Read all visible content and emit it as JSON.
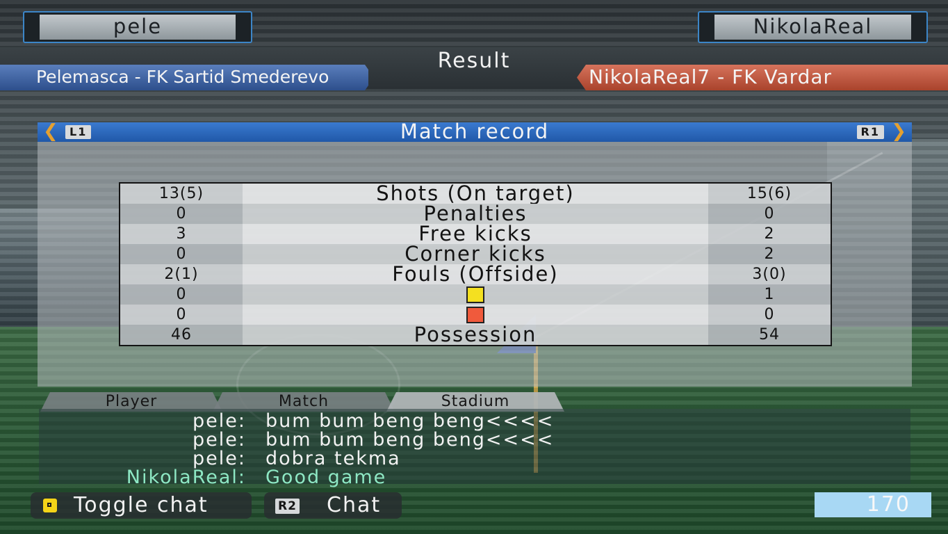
{
  "players": {
    "left": "pele",
    "right": "NikolaReal"
  },
  "screen_title": "Result",
  "teams": {
    "left": "Pelemasca - FK Sartid Smederevo",
    "right": "NikolaReal7 - FK Vardar"
  },
  "panel": {
    "title": "Match record",
    "left_button": "L1",
    "right_button": "R1"
  },
  "stats": [
    {
      "left": "13(5)",
      "label": "Shots (On target)",
      "right": "15(6)"
    },
    {
      "left": "0",
      "label": "Penalties",
      "right": "0"
    },
    {
      "left": "3",
      "label": "Free kicks",
      "right": "2"
    },
    {
      "left": "0",
      "label": "Corner kicks",
      "right": "2"
    },
    {
      "left": "2(1)",
      "label": "Fouls (Offside)",
      "right": "3(0)"
    },
    {
      "left": "0",
      "label": "",
      "icon": "yellow-card-icon",
      "color": "#f4e020",
      "right": "1"
    },
    {
      "left": "0",
      "label": "",
      "icon": "red-card-icon",
      "color": "#f05a3c",
      "right": "0"
    },
    {
      "left": "46",
      "label": "Possession",
      "right": "54"
    }
  ],
  "chat_tabs": [
    "Player",
    "Match",
    "Stadium"
  ],
  "chat": [
    {
      "user": "pele:",
      "message": "bum bum beng beng<<<<"
    },
    {
      "user": "pele:",
      "message": "bum bum beng beng<<<<"
    },
    {
      "user": "pele:",
      "message": "dobra tekma"
    },
    {
      "user": "NikolaReal:",
      "message": "Good game"
    }
  ],
  "footer": {
    "toggle_chat": "Toggle chat",
    "r2_button": "R2",
    "chat": "Chat",
    "counter": "170"
  },
  "colors": {
    "left_team": "#3a5e9e",
    "right_team": "#c05a40",
    "panel_header": "#2a68bc",
    "chat_highlight": "#8ee8c4"
  }
}
